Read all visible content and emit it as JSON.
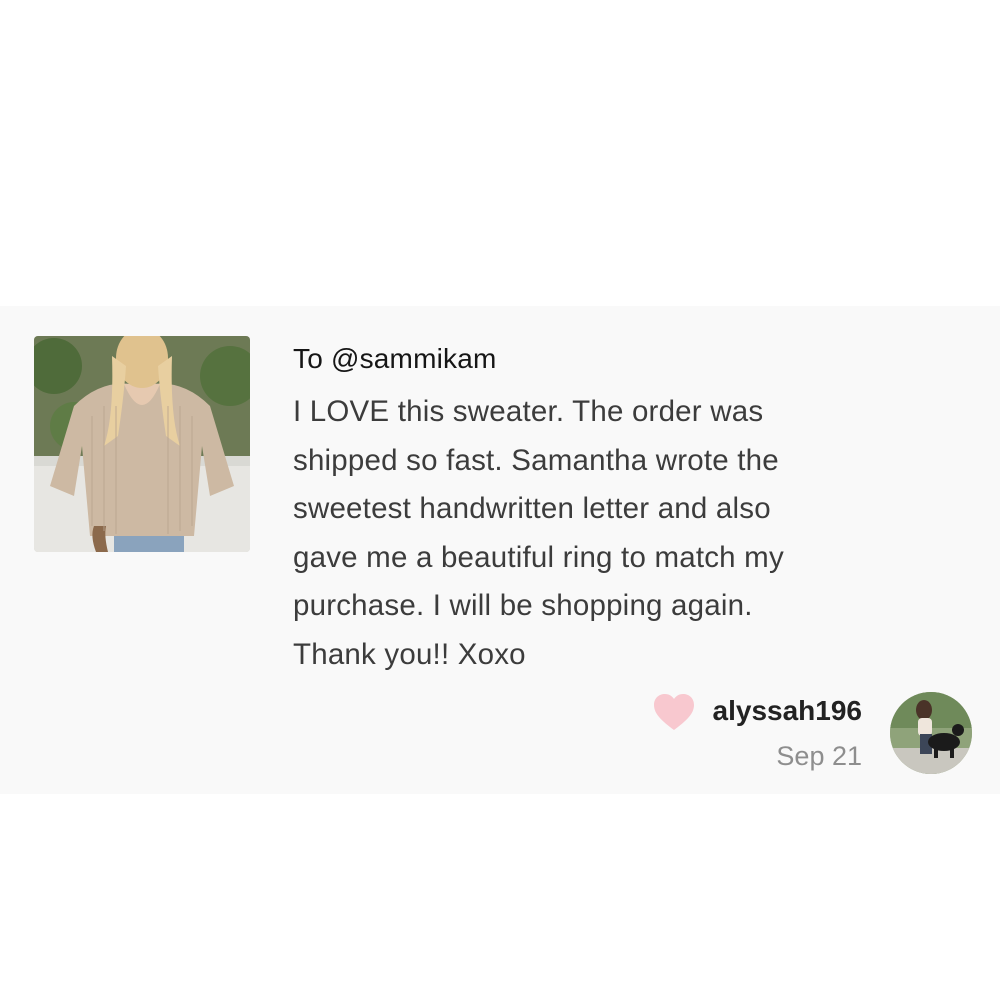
{
  "review": {
    "recipient": "To @sammikam",
    "message_lines": [
      "I LOVE this sweater. The order was",
      "shipped so fast. Samantha wrote the",
      "sweetest handwritten letter and also",
      "gave me a beautiful ring to match my",
      "purchase. I will be shopping again.",
      "Thank you!! Xoxo"
    ],
    "reviewer": "alyssah196",
    "date": "Sep 21",
    "product_image_icon": "product-photo",
    "like_icon": "heart-icon",
    "avatar_icon": "avatar-photo"
  },
  "colors": {
    "card_background": "#f9f9f9",
    "heart": "#f8c8cf",
    "date_text": "#8e8e8e",
    "body_text": "#3c3c3c"
  }
}
